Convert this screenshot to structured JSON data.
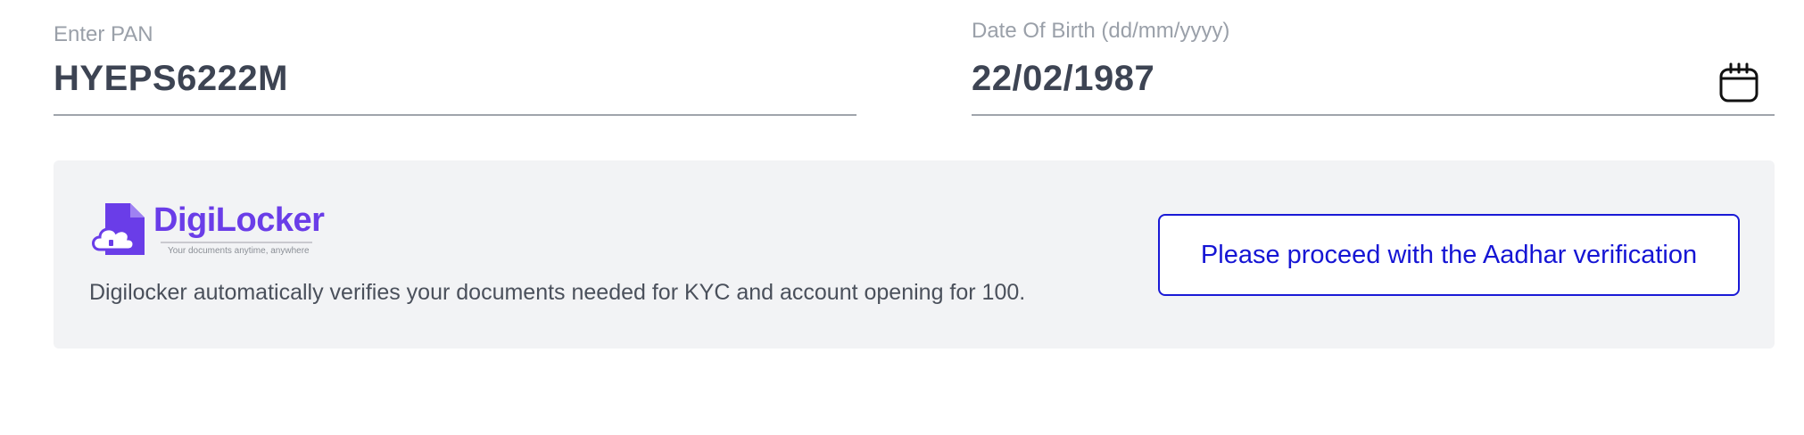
{
  "pan": {
    "label": "Enter PAN",
    "value": "HYEPS6222M"
  },
  "dob": {
    "label": "Date Of Birth (dd/mm/yyyy)",
    "value": "22/02/1987",
    "icon": "calendar-icon"
  },
  "digilocker": {
    "logo_name": "DigiLocker",
    "logo_tagline": "Your documents anytime, anywhere",
    "description": "Digilocker automatically verifies your documents needed for KYC and account opening for 100.",
    "button_label": "Please proceed with the Aadhar verification",
    "accent_color": "#6a3de8",
    "button_color": "#1a1ad6",
    "panel_bg": "#f2f3f5"
  }
}
